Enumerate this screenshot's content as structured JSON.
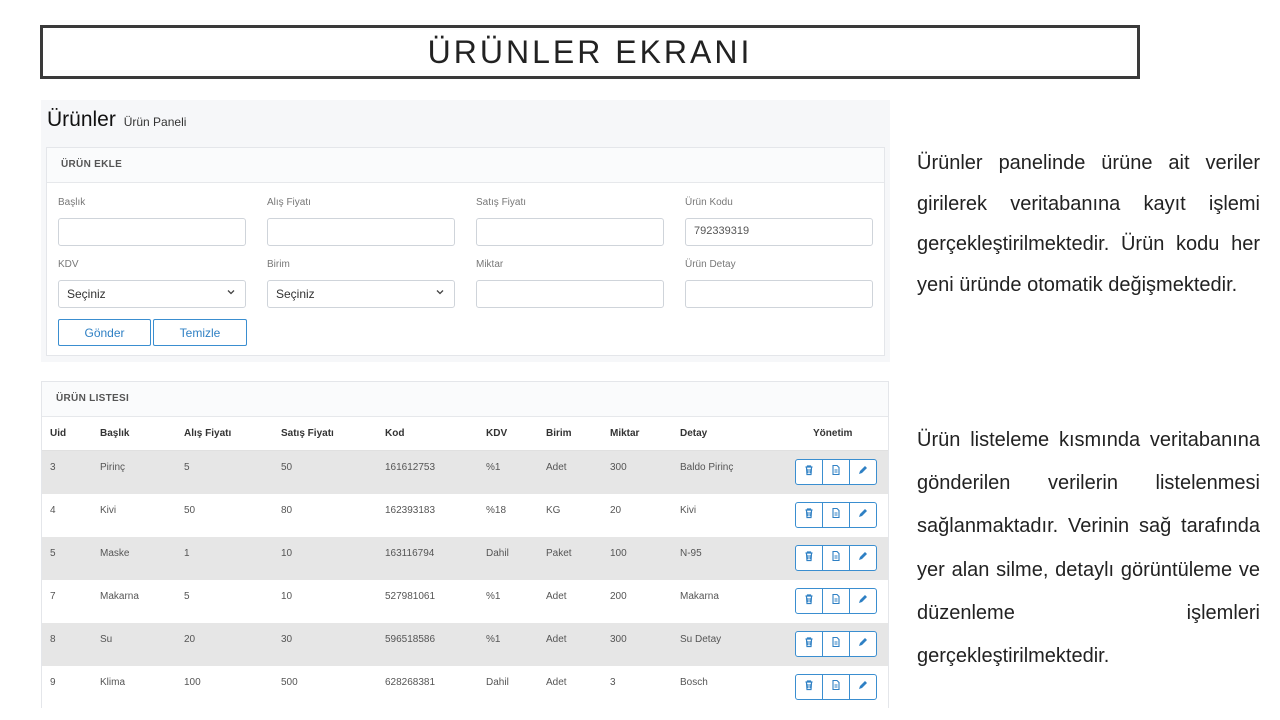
{
  "slide_title": "ÜRÜNLER EKRANI",
  "panel": {
    "title": "Ürünler",
    "subtitle": "Ürün Paneli",
    "form_header": "ÜRÜN EKLE",
    "fields": {
      "baslik": {
        "label": "Başlık",
        "value": ""
      },
      "alis": {
        "label": "Alış Fiyatı",
        "value": ""
      },
      "satis": {
        "label": "Satış Fiyatı",
        "value": ""
      },
      "kod": {
        "label": "Ürün Kodu",
        "value": "792339319"
      },
      "kdv": {
        "label": "KDV",
        "selected": "Seçiniz"
      },
      "birim": {
        "label": "Birim",
        "selected": "Seçiniz"
      },
      "miktar": {
        "label": "Miktar",
        "value": ""
      },
      "detay": {
        "label": "Ürün Detay",
        "value": ""
      }
    },
    "buttons": {
      "send": "Gönder",
      "clear": "Temizle"
    }
  },
  "list": {
    "header": "ÜRÜN LISTESI",
    "columns": [
      "Uid",
      "Başlık",
      "Alış Fiyatı",
      "Satış Fiyatı",
      "Kod",
      "KDV",
      "Birim",
      "Miktar",
      "Detay",
      "Yönetim"
    ],
    "rows": [
      [
        "3",
        "Pirinç",
        "5",
        "50",
        "161612753",
        "%1",
        "Adet",
        "300",
        "Baldo Pirinç"
      ],
      [
        "4",
        "Kivi",
        "50",
        "80",
        "162393183",
        "%18",
        "KG",
        "20",
        "Kivi"
      ],
      [
        "5",
        "Maske",
        "1",
        "10",
        "163116794",
        "Dahil",
        "Paket",
        "100",
        "N-95"
      ],
      [
        "7",
        "Makarna",
        "5",
        "10",
        "527981061",
        "%1",
        "Adet",
        "200",
        "Makarna"
      ],
      [
        "8",
        "Su",
        "20",
        "30",
        "596518586",
        "%1",
        "Adet",
        "300",
        "Su Detay"
      ],
      [
        "9",
        "Klima",
        "100",
        "500",
        "628268381",
        "Dahil",
        "Adet",
        "3",
        "Bosch"
      ]
    ],
    "action_icons": [
      "trash-icon",
      "document-icon",
      "pencil-icon"
    ]
  },
  "description": {
    "para1": "Ürünler panelinde ürüne ait veriler girilerek veritabanına kayıt işlemi gerçekleştirilmektedir. Ürün kodu her yeni üründe otomatik değişmektedir.",
    "para2": "Ürün listeleme kısmında veritabanına gönderilen verilerin listelenmesi sağlanmaktadır. Verinin sağ tarafında yer alan silme, detaylı görüntüleme ve düzenleme işlemleri gerçekleştirilmektedir."
  },
  "colors": {
    "accent": "#3a8ed0",
    "row_stripe": "#e6e6e6"
  }
}
